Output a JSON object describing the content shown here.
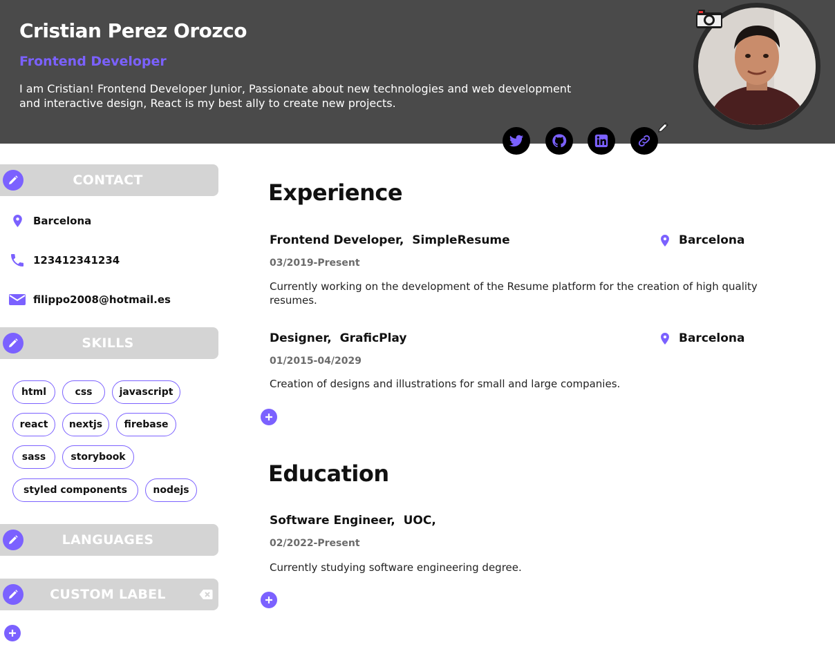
{
  "header": {
    "name": "Cristian Perez Orozco",
    "role": "Frontend Developer",
    "bio": "I am Cristian! Frontend Developer Junior, Passionate about new technologies and web development and interactive design, React is my best ally to create new projects.",
    "social": [
      {
        "icon": "twitter-icon"
      },
      {
        "icon": "github-icon"
      },
      {
        "icon": "linkedin-icon"
      },
      {
        "icon": "link-icon"
      }
    ]
  },
  "sidebar": {
    "contact": {
      "title": "CONTACT",
      "location": "Barcelona",
      "phone": "123412341234",
      "email": "filippo2008@hotmail.es"
    },
    "skills": {
      "title": "SKILLS",
      "items": [
        "html",
        "css",
        "javascript",
        "react",
        "nextjs",
        "firebase",
        "sass",
        "storybook",
        "styled components",
        "nodejs"
      ]
    },
    "languages": {
      "title": "LANGUAGES"
    },
    "custom": {
      "title": "CUSTOM LABEL"
    }
  },
  "experience": {
    "title": "Experience",
    "items": [
      {
        "position": "Frontend Developer,",
        "company": "SimpleResume",
        "location": "Barcelona",
        "date": "03/2019-Present",
        "description": "Currently working on the development of the Resume platform for the creation of high quality resumes."
      },
      {
        "position": "Designer,",
        "company": "GraficPlay",
        "location": "Barcelona",
        "date": "01/2015-04/2029",
        "description": "Creation of designs and illustrations for small and large companies."
      }
    ]
  },
  "education": {
    "title": "Education",
    "items": [
      {
        "degree": "Software Engineer,",
        "school": "UOC,",
        "date": "02/2022-Present",
        "description": "Currently studying software engineering degree."
      }
    ]
  },
  "colors": {
    "accent": "#7b61ff",
    "header_bg": "#4a4a4a",
    "section_bg": "#d4d4d4"
  }
}
